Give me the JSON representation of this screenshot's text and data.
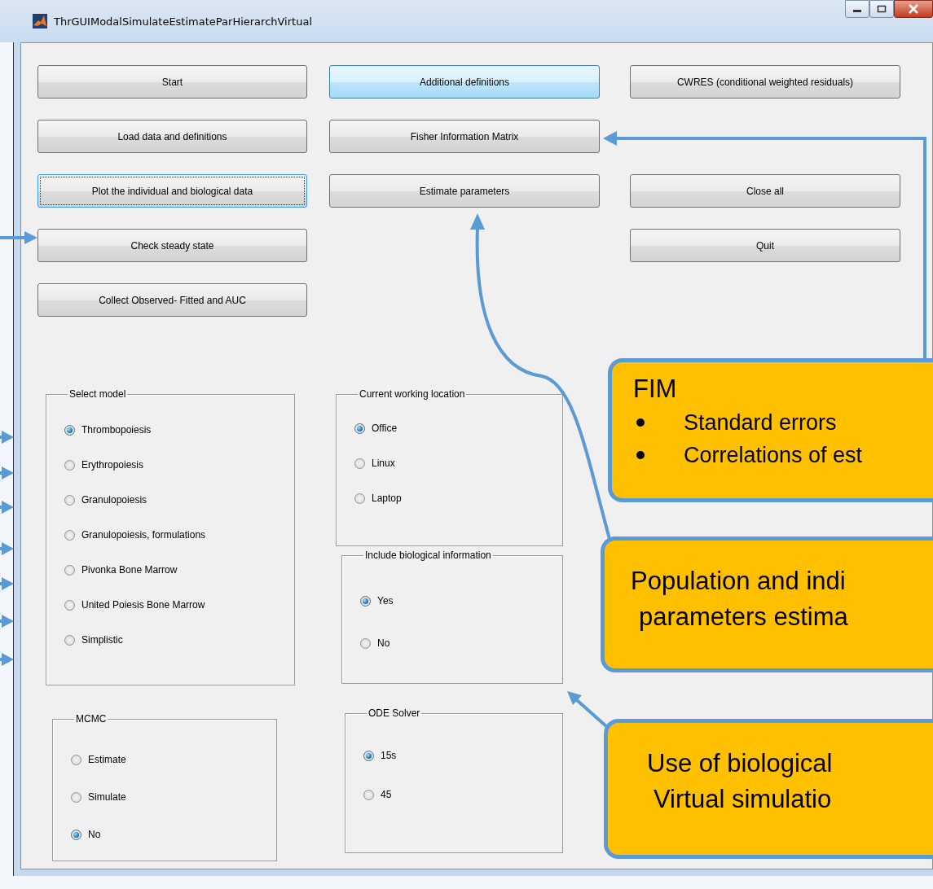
{
  "window": {
    "title": "ThrGUIModalSimulateEstimateParHierarchVirtual"
  },
  "button_columns": [
    [
      {
        "label": "Start",
        "highlighted": false,
        "focused": false
      },
      {
        "label": "Load data and definitions",
        "highlighted": false,
        "focused": false
      },
      {
        "label": "Plot the individual and biological data",
        "highlighted": false,
        "focused": true
      },
      {
        "label": "Check steady state",
        "highlighted": false,
        "focused": false
      },
      {
        "label": "Collect Observed- Fitted and AUC",
        "highlighted": false,
        "focused": false
      }
    ],
    [
      {
        "label": "Additional definitions",
        "highlighted": true,
        "focused": false
      },
      {
        "label": "Fisher Information Matrix",
        "highlighted": false,
        "focused": false
      },
      {
        "label": "Estimate parameters",
        "highlighted": false,
        "focused": false
      }
    ],
    [
      {
        "label": "CWRES (conditional weighted residuals)",
        "highlighted": false,
        "focused": false
      },
      {
        "label": "Close all",
        "highlighted": false,
        "focused": false
      },
      {
        "label": "Quit",
        "highlighted": false,
        "focused": false
      }
    ]
  ],
  "panel_columns": [
    [
      {
        "title": "Select model",
        "options": [
          {
            "label": "Thrombopoiesis",
            "selected": true
          },
          {
            "label": "Erythropoiesis",
            "selected": false
          },
          {
            "label": "Granulopoiesis",
            "selected": false
          },
          {
            "label": "Granulopoiesis, formulations",
            "selected": false
          },
          {
            "label": "Pivonka Bone Marrow",
            "selected": false
          },
          {
            "label": "United Poiesis Bone Marrow",
            "selected": false
          },
          {
            "label": "Simplistic",
            "selected": false
          }
        ]
      },
      {
        "title": "MCMC",
        "options": [
          {
            "label": "Estimate",
            "selected": false
          },
          {
            "label": "Simulate",
            "selected": false
          },
          {
            "label": "No",
            "selected": true
          }
        ]
      }
    ],
    [
      {
        "title": "Current working location",
        "options": [
          {
            "label": "Office",
            "selected": true
          },
          {
            "label": "Linux",
            "selected": false
          },
          {
            "label": "Laptop",
            "selected": false
          }
        ]
      },
      {
        "title": "Include biological information",
        "options": [
          {
            "label": "Yes",
            "selected": true
          },
          {
            "label": "No",
            "selected": false
          }
        ]
      },
      {
        "title": "ODE Solver",
        "options": [
          {
            "label": "15s",
            "selected": true
          },
          {
            "label": "45",
            "selected": false
          }
        ]
      }
    ]
  ],
  "callouts": [
    {
      "kind": "list",
      "title": "FIM",
      "bullets": [
        "Standard errors",
        "Correlations of est"
      ]
    },
    {
      "kind": "text",
      "lines": [
        "Population and indi",
        "parameters estima"
      ]
    },
    {
      "kind": "text",
      "lines": [
        "Use of biological",
        "Virtual simulatio"
      ]
    }
  ]
}
